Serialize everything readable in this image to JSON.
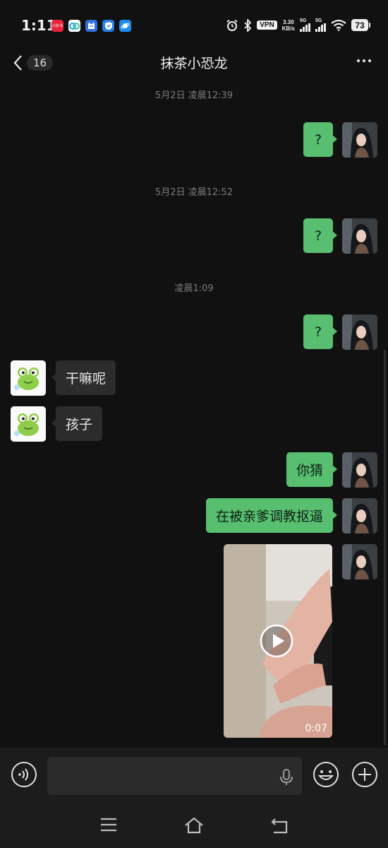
{
  "status_bar": {
    "time": "1:11",
    "app_icons": [
      {
        "icon": "xiaohongshu-app-icon",
        "label": "小红书",
        "color": "#e7263d"
      },
      {
        "icon": "baidu-netdisk-app-icon",
        "label": "",
        "color": "#ffffff"
      },
      {
        "icon": "cat-app-icon",
        "label": "",
        "color": "#2f6fe0"
      },
      {
        "icon": "shield-app-icon",
        "label": "",
        "color": "#2b7de9"
      },
      {
        "icon": "planet-app-icon",
        "label": "",
        "color": "#1f8cf0"
      }
    ],
    "vpn": "VPN",
    "speed_value": "3.30",
    "speed_unit": "KB/s",
    "sim1": "5G",
    "sim2": "5G",
    "battery": "73"
  },
  "header": {
    "back_count": "16",
    "title": "抹茶小恐龙"
  },
  "messages": {
    "ts1": "5月2日 凌晨12:39",
    "m1": "?",
    "ts2": "5月2日 凌晨12:52",
    "m2": "?",
    "ts3": "凌晨1:09",
    "m3": "?",
    "m4": "干嘛呢",
    "m5": "孩子",
    "m6": "你猜",
    "m7": "在被亲爹调教抠逼",
    "video_duration": "0:07"
  },
  "input": {
    "placeholder": "",
    "value": ""
  },
  "colors": {
    "background": "#111111",
    "outgoing_bubble": "#57bf6f",
    "incoming_bubble": "#2c2c2c"
  }
}
